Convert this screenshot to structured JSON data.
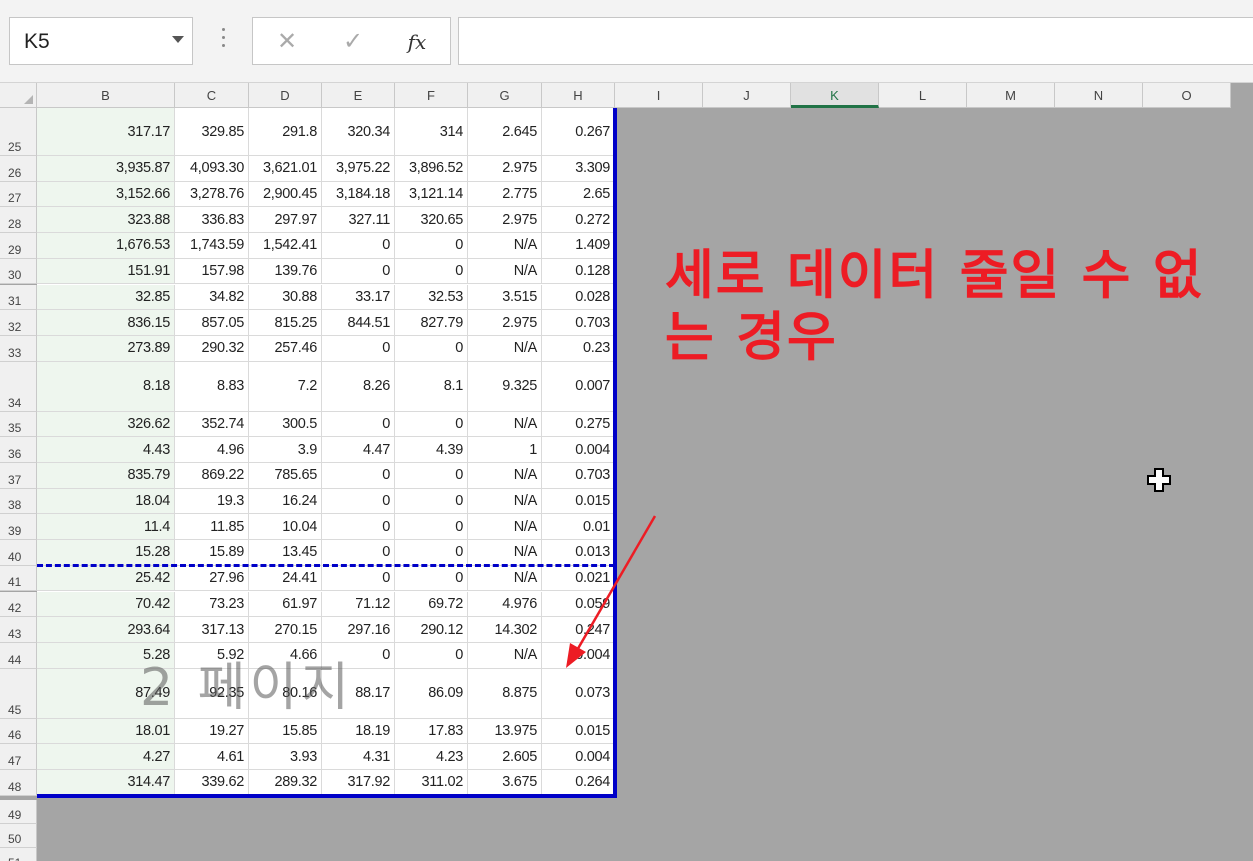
{
  "name_box": {
    "value": "K5"
  },
  "formula_bar": {
    "cancel_glyph": "✕",
    "enter_glyph": "✓",
    "fx_label": "fx",
    "value": ""
  },
  "columns": [
    "B",
    "C",
    "D",
    "E",
    "F",
    "G",
    "H",
    "I",
    "J",
    "K",
    "L",
    "M",
    "N",
    "O"
  ],
  "active_column": "K",
  "rows": [
    {
      "num": "25",
      "cells": [
        "317.17",
        "329.85",
        "291.8",
        "320.34",
        "314",
        "2.645",
        "0.267"
      ]
    },
    {
      "num": "26",
      "cells": [
        "3,935.87",
        "4,093.30",
        "3,621.01",
        "3,975.22",
        "3,896.52",
        "2.975",
        "3.309"
      ]
    },
    {
      "num": "27",
      "cells": [
        "3,152.66",
        "3,278.76",
        "2,900.45",
        "3,184.18",
        "3,121.14",
        "2.775",
        "2.65"
      ]
    },
    {
      "num": "28",
      "cells": [
        "323.88",
        "336.83",
        "297.97",
        "327.11",
        "320.65",
        "2.975",
        "0.272"
      ]
    },
    {
      "num": "29",
      "cells": [
        "1,676.53",
        "1,743.59",
        "1,542.41",
        "0",
        "0",
        "N/A",
        "1.409"
      ]
    },
    {
      "num": "30",
      "cells": [
        "151.91",
        "157.98",
        "139.76",
        "0",
        "0",
        "N/A",
        "0.128"
      ]
    },
    {
      "num": "31",
      "cells": [
        "32.85",
        "34.82",
        "30.88",
        "33.17",
        "32.53",
        "3.515",
        "0.028"
      ]
    },
    {
      "num": "32",
      "cells": [
        "836.15",
        "857.05",
        "815.25",
        "844.51",
        "827.79",
        "2.975",
        "0.703"
      ]
    },
    {
      "num": "33",
      "cells": [
        "273.89",
        "290.32",
        "257.46",
        "0",
        "0",
        "N/A",
        "0.23"
      ]
    },
    {
      "num": "34",
      "cells": [
        "8.18",
        "8.83",
        "7.2",
        "8.26",
        "8.1",
        "9.325",
        "0.007"
      ]
    },
    {
      "num": "35",
      "cells": [
        "326.62",
        "352.74",
        "300.5",
        "0",
        "0",
        "N/A",
        "0.275"
      ]
    },
    {
      "num": "36",
      "cells": [
        "4.43",
        "4.96",
        "3.9",
        "4.47",
        "4.39",
        "1",
        "0.004"
      ]
    },
    {
      "num": "37",
      "cells": [
        "835.79",
        "869.22",
        "785.65",
        "0",
        "0",
        "N/A",
        "0.703"
      ]
    },
    {
      "num": "38",
      "cells": [
        "18.04",
        "19.3",
        "16.24",
        "0",
        "0",
        "N/A",
        "0.015"
      ]
    },
    {
      "num": "39",
      "cells": [
        "11.4",
        "11.85",
        "10.04",
        "0",
        "0",
        "N/A",
        "0.01"
      ]
    },
    {
      "num": "40",
      "cells": [
        "15.28",
        "15.89",
        "13.45",
        "0",
        "0",
        "N/A",
        "0.013"
      ]
    },
    {
      "num": "41",
      "cells": [
        "25.42",
        "27.96",
        "24.41",
        "0",
        "0",
        "N/A",
        "0.021"
      ]
    },
    {
      "num": "42",
      "cells": [
        "70.42",
        "73.23",
        "61.97",
        "71.12",
        "69.72",
        "4.976",
        "0.059"
      ]
    },
    {
      "num": "43",
      "cells": [
        "293.64",
        "317.13",
        "270.15",
        "297.16",
        "290.12",
        "14.302",
        "0.247"
      ]
    },
    {
      "num": "44",
      "cells": [
        "5.28",
        "5.92",
        "4.66",
        "0",
        "0",
        "N/A",
        "0.004"
      ]
    },
    {
      "num": "45",
      "cells": [
        "87.49",
        "92.35",
        "80.16",
        "88.17",
        "86.09",
        "8.875",
        "0.073"
      ]
    },
    {
      "num": "46",
      "cells": [
        "18.01",
        "19.27",
        "15.85",
        "18.19",
        "17.83",
        "13.975",
        "0.015"
      ]
    },
    {
      "num": "47",
      "cells": [
        "4.27",
        "4.61",
        "3.93",
        "4.31",
        "4.23",
        "2.605",
        "0.004"
      ]
    },
    {
      "num": "48",
      "cells": [
        "314.47",
        "339.62",
        "289.32",
        "317.92",
        "311.02",
        "3.675",
        "0.264"
      ]
    }
  ],
  "empty_rows": [
    "49",
    "50",
    "51"
  ],
  "page_watermark": "2 페이지",
  "annotation": {
    "text": "세로 데이터 줄일 수 없는 경우",
    "color": "#ed1c24"
  },
  "colors": {
    "print_area_border": "#0000c8",
    "background_gray": "#a5a5a5",
    "active_header": "#217346"
  },
  "icons": {
    "cursor": "plus-cursor-icon",
    "dropdown": "chevron-down-icon"
  }
}
